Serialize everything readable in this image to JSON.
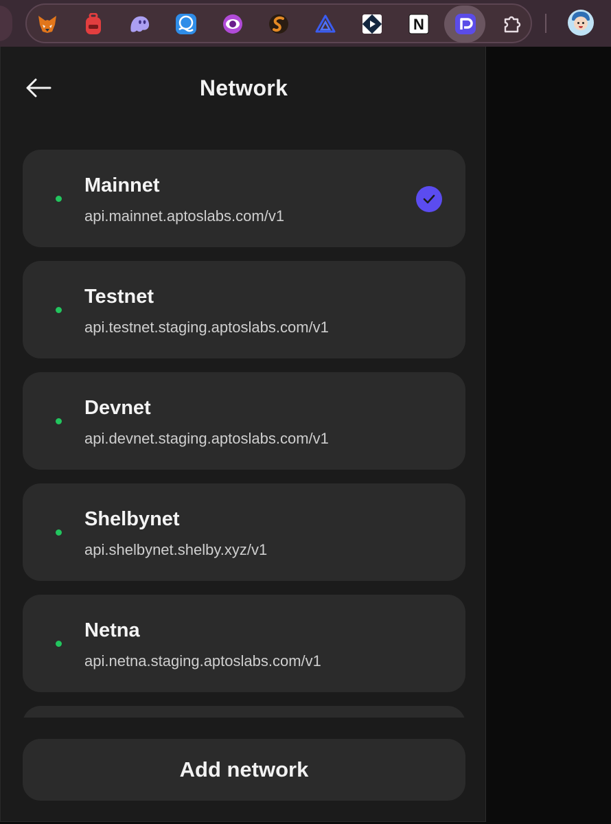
{
  "extensions": [
    {
      "name": "fox-wallet-icon",
      "color": "#e2761b"
    },
    {
      "name": "backpack-icon",
      "color": "#e33e3f"
    },
    {
      "name": "phantom-ghost-icon",
      "color": "#ab9ff2"
    },
    {
      "name": "wave-wallet-icon",
      "color": "#2f8de8"
    },
    {
      "name": "purple-eye-icon",
      "color": "#b14bd8"
    },
    {
      "name": "s-logo-icon",
      "color": "#d8741c"
    },
    {
      "name": "triangle-logo-icon",
      "color": "#3a5cf0"
    },
    {
      "name": "diamond-play-icon",
      "color": "#13263f"
    },
    {
      "name": "notion-icon",
      "text": "N"
    },
    {
      "name": "petra-wallet-icon",
      "color": "#5b4ce8"
    },
    {
      "name": "puzzle-piece-icon"
    }
  ],
  "header": {
    "title": "Network",
    "back_icon": "arrow-left-icon"
  },
  "networks": [
    {
      "name": "Mainnet",
      "url": "api.mainnet.aptoslabs.com/v1",
      "status": "online",
      "selected": true
    },
    {
      "name": "Testnet",
      "url": "api.testnet.staging.aptoslabs.com/v1",
      "status": "online",
      "selected": false
    },
    {
      "name": "Devnet",
      "url": "api.devnet.staging.aptoslabs.com/v1",
      "status": "online",
      "selected": false
    },
    {
      "name": "Shelbynet",
      "url": "api.shelbynet.shelby.xyz/v1",
      "status": "online",
      "selected": false
    },
    {
      "name": "Netna",
      "url": "api.netna.staging.aptoslabs.com/v1",
      "status": "online",
      "selected": false
    }
  ],
  "add_network_label": "Add network",
  "colors": {
    "status_online": "#22c55e",
    "selected_check": "#5b4cf0",
    "card_bg": "#2b2b2b",
    "panel_bg": "#1b1b1b"
  }
}
